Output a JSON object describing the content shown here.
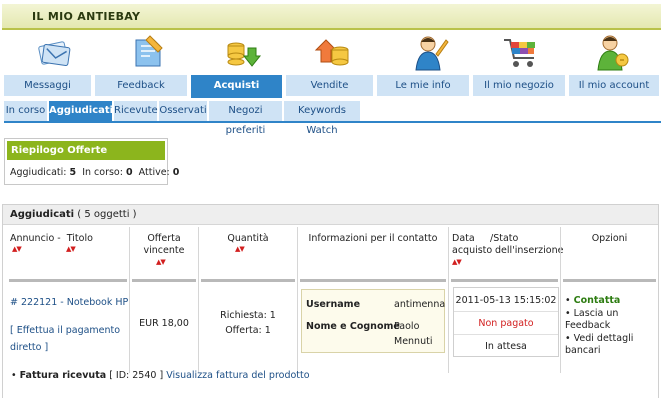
{
  "header": {
    "title": "IL MIO ANTIEBAY"
  },
  "main_tabs": [
    {
      "label": "Messaggi"
    },
    {
      "label": "Feedback"
    },
    {
      "label": "Acquisti"
    },
    {
      "label": "Vendite"
    },
    {
      "label": "Le mie info"
    },
    {
      "label": "Il mio negozio"
    },
    {
      "label": "Il mio account"
    }
  ],
  "sub_tabs": [
    {
      "label": "In corso"
    },
    {
      "label": "Aggiudicati"
    },
    {
      "label": "Ricevute"
    },
    {
      "label": "Osservati"
    },
    {
      "label": "Negozi preferiti"
    },
    {
      "label": "Keywords Watch"
    }
  ],
  "summary": {
    "title": "Riepilogo Offerte",
    "won_label": "Aggiudicati:",
    "won_value": "5",
    "ongoing_label": "In corso:",
    "ongoing_value": "0",
    "active_label": "Attive:",
    "active_value": "0"
  },
  "table": {
    "title": "Aggiudicati",
    "count": "( 5 oggetti )",
    "headers": {
      "annuncio": "Annuncio",
      "sep": "-",
      "titolo": "Titolo",
      "offerta_l1": "Offerta",
      "offerta_l2": "vincente",
      "quantita": "Quantità",
      "info": "Informazioni per il contatto",
      "data_l1": "Data",
      "data_l2": "acquisto",
      "stato_l1": "/Stato",
      "stato_l2": "dell'inserzione",
      "opzioni": "Opzioni"
    },
    "row": {
      "item": "# 222121 - Notebook HP",
      "payment_link": "[ Effettua il pagamento",
      "payment_link_2": "diretto ]",
      "price": "EUR 18,00",
      "qty_req": "Richiesta: 1",
      "qty_off": "Offerta: 1",
      "username_label": "Username",
      "username_value": "antimenna",
      "name_label": "Nome e Cognome",
      "name_value_1": "Paolo",
      "name_value_2": "Mennuti",
      "date": "2011-05-13 15:15:02",
      "payment_status": "Non pagato",
      "listing_status": "In attesa",
      "opt_contact": "Contatta",
      "opt_feedback": "Lascia un Feedback",
      "opt_banks_1": "Vedi dettagli",
      "opt_banks_2": "bancari"
    },
    "invoice": {
      "label": "Fattura ricevuta",
      "id": "[ ID: 2540 ]",
      "link": "Visualizza fattura del prodotto"
    }
  },
  "colors": {
    "accent": "#2f84c8",
    "tab_bg": "#cfe3f5",
    "green": "#8cb51d",
    "header_bar": "#e4e8b0"
  }
}
